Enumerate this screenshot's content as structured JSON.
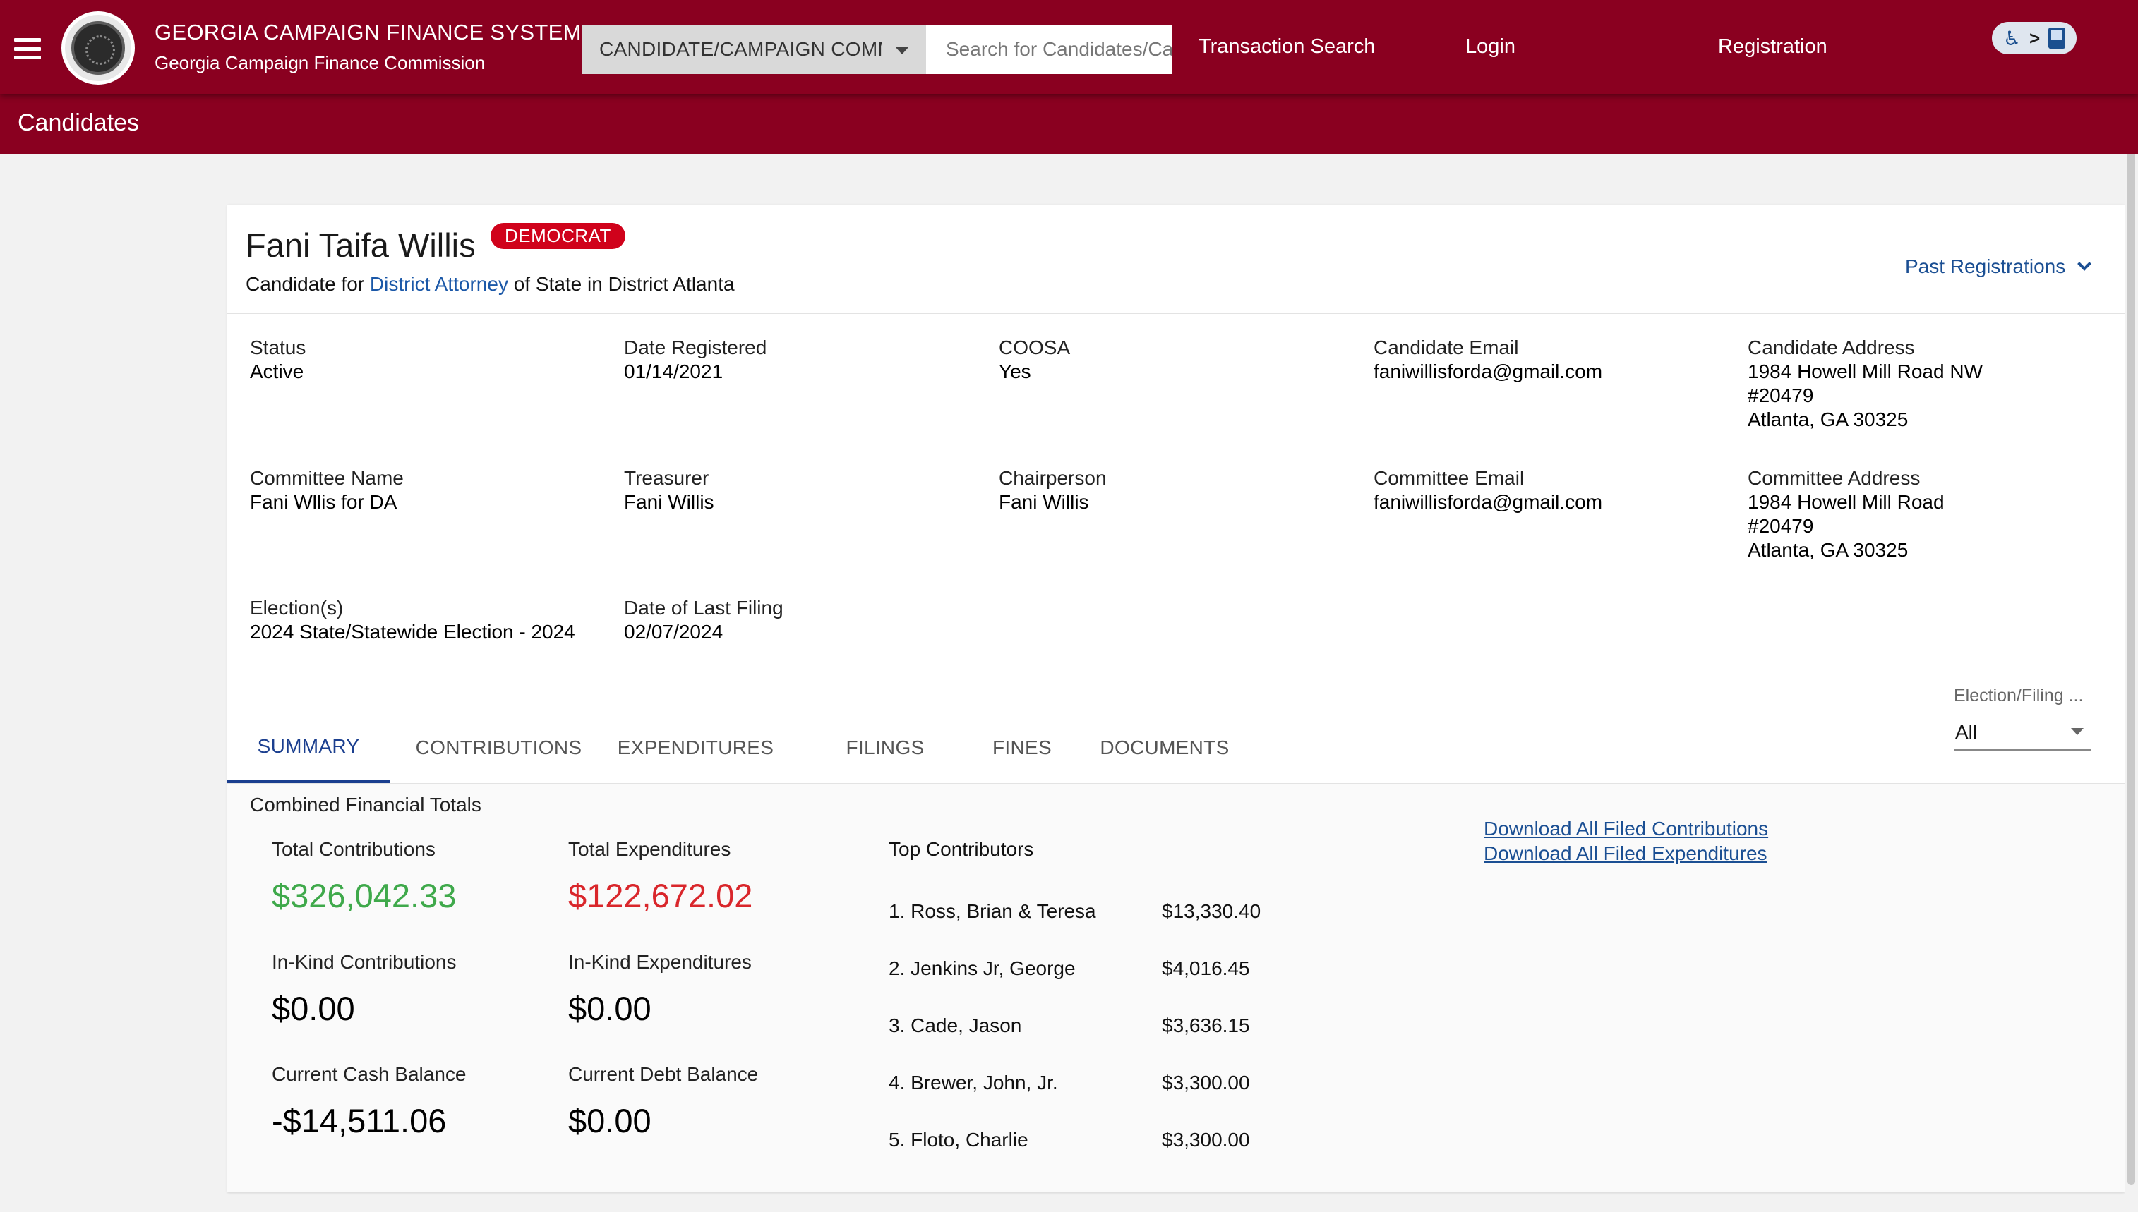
{
  "header": {
    "title": "GEORGIA CAMPAIGN FINANCE SYSTEM",
    "subtitle": "Georgia Campaign Finance Commission",
    "menu_icon": "hamburger-menu-icon",
    "logo_icon": "state-seal-logo",
    "search_category": "CANDIDATE/CAMPAIGN COMM",
    "search_placeholder": "Search for Candidates/Campaign Committees",
    "nav": {
      "transaction_search": "Transaction Search",
      "login": "Login",
      "registration": "Registration"
    },
    "accessibility_toggle": {
      "icon": "accessibility-toggle-icon",
      "arrow": ">"
    }
  },
  "subheader": {
    "title": "Candidates"
  },
  "candidate": {
    "name": "Fani Taifa Willis",
    "party": "DEMOCRAT",
    "desc_prefix": "Candidate for",
    "office_link": "District Attorney",
    "desc_suffix": "of State in District Atlanta",
    "past_registrations": "Past Registrations"
  },
  "details": {
    "status": {
      "label": "Status",
      "value": "Active"
    },
    "date_registered": {
      "label": "Date Registered",
      "value": "01/14/2021"
    },
    "coosa": {
      "label": "COOSA",
      "value": "Yes"
    },
    "candidate_email": {
      "label": "Candidate Email",
      "value": "faniwillisforda@gmail.com"
    },
    "candidate_address": {
      "label": "Candidate Address",
      "line1": "1984 Howell Mill Road NW",
      "line2": "#20479",
      "line3": "Atlanta, GA 30325"
    },
    "committee_name": {
      "label": "Committee Name",
      "value": "Fani Wllis for DA"
    },
    "treasurer": {
      "label": "Treasurer",
      "value": "Fani Willis"
    },
    "chairperson": {
      "label": "Chairperson",
      "value": "Fani Willis"
    },
    "committee_email": {
      "label": "Committee Email",
      "value": "faniwillisforda@gmail.com"
    },
    "committee_address": {
      "label": "Committee Address",
      "line1": "1984 Howell Mill Road",
      "line2": "#20479",
      "line3": "Atlanta, GA 30325"
    },
    "elections": {
      "label": "Election(s)",
      "value": "2024 State/Statewide Election - 2024"
    },
    "last_filing": {
      "label": "Date of Last Filing",
      "value": "02/07/2024"
    }
  },
  "tabs": [
    "SUMMARY",
    "CONTRIBUTIONS",
    "EXPENDITURES",
    "FILINGS",
    "FINES",
    "DOCUMENTS"
  ],
  "active_tab": "SUMMARY",
  "filter": {
    "label": "Election/Filing ...",
    "value": "All"
  },
  "summary": {
    "section_title": "Combined Financial Totals",
    "total_contributions": {
      "label": "Total Contributions",
      "value": "$326,042.33"
    },
    "total_expenditures": {
      "label": "Total Expenditures",
      "value": "$122,672.02"
    },
    "inkind_contributions": {
      "label": "In-Kind Contributions",
      "value": "$0.00"
    },
    "inkind_expenditures": {
      "label": "In-Kind Expenditures",
      "value": "$0.00"
    },
    "cash_balance": {
      "label": "Current Cash Balance",
      "value": "-$14,511.06"
    },
    "debt_balance": {
      "label": "Current Debt Balance",
      "value": "$0.00"
    },
    "top_contributors_title": "Top Contributors",
    "top_contributors": [
      {
        "name": "1. Ross, Brian & Teresa",
        "amount": "$13,330.40"
      },
      {
        "name": "2. Jenkins Jr, George",
        "amount": "$4,016.45"
      },
      {
        "name": "3. Cade, Jason",
        "amount": "$3,636.15"
      },
      {
        "name": "4. Brewer, John, Jr.",
        "amount": "$3,300.00"
      },
      {
        "name": "5. Floto, Charlie",
        "amount": "$3,300.00"
      }
    ],
    "download_contributions": "Download All Filed Contributions",
    "download_expenditures": "Download All Filed Expenditures"
  },
  "colors": {
    "brand": "#8a0020",
    "party_badge": "#d0021b",
    "link": "#1b58a8",
    "active_tab": "#1b3f8f",
    "positive": "#3fa94b",
    "negative": "#d9262b"
  }
}
